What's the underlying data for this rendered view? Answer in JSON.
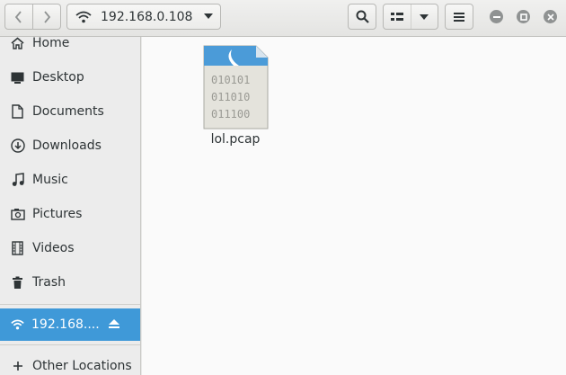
{
  "header": {
    "back_icon": "chevron-left-icon",
    "forward_icon": "chevron-right-icon",
    "location_icon": "wifi-icon",
    "location_label": "192.168.0.108",
    "location_dropdown_icon": "triangle-down-icon",
    "search_icon": "search-icon",
    "view_icon": "list-view-icon",
    "view_dropdown_icon": "triangle-down-icon",
    "menu_icon": "hamburger-menu-icon",
    "window_controls": [
      "minimize-icon",
      "maximize-icon",
      "close-icon"
    ]
  },
  "sidebar": {
    "items": [
      {
        "label": "Home",
        "icon": "home-icon"
      },
      {
        "label": "Desktop",
        "icon": "desktop-icon"
      },
      {
        "label": "Documents",
        "icon": "document-icon"
      },
      {
        "label": "Downloads",
        "icon": "download-icon"
      },
      {
        "label": "Music",
        "icon": "music-note-icon"
      },
      {
        "label": "Pictures",
        "icon": "camera-icon"
      },
      {
        "label": "Videos",
        "icon": "film-icon"
      },
      {
        "label": "Trash",
        "icon": "trash-icon"
      }
    ],
    "network": {
      "label": "192.168....",
      "icon": "wifi-icon",
      "eject_icon": "eject-icon",
      "selected": true
    },
    "other": {
      "label": "Other Locations",
      "icon": "plus-icon"
    }
  },
  "files": [
    {
      "name": "lol.pcap",
      "icon": "binary-file-icon",
      "icon_lines": [
        "010101",
        "011010",
        "011100"
      ]
    }
  ],
  "colors": {
    "accent": "#3f99d8",
    "sidebar_bg": "#ececec",
    "main_bg": "#fafafa",
    "header_bg": "#e8e8e7"
  }
}
